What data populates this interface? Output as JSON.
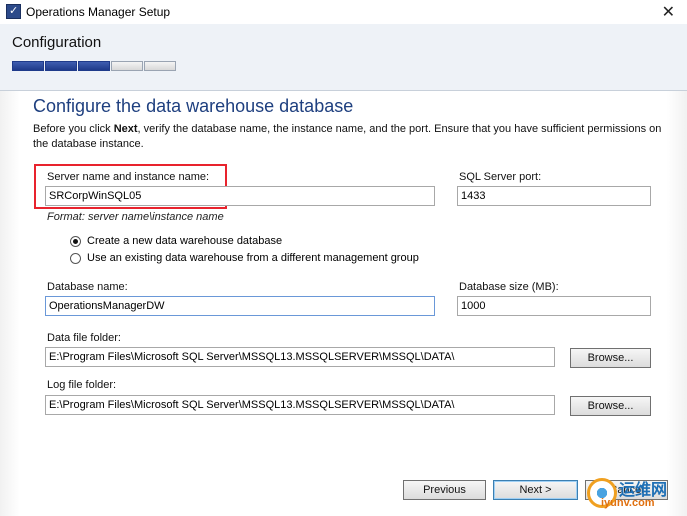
{
  "window": {
    "title": "Operations Manager Setup",
    "close_glyph": "✕"
  },
  "header": {
    "title": "Configuration",
    "progress": {
      "total_steps": 5,
      "completed_steps": 3,
      "filled_color": "#1e3a8a"
    }
  },
  "page": {
    "title": "Configure the data warehouse database",
    "instructions_pre": "Before you click ",
    "instructions_bold": "Next",
    "instructions_post": ", verify the database name, the instance name, and the port. Ensure that you have sufficient permissions on the database instance."
  },
  "server": {
    "label": "Server name and instance name:",
    "value": "SRCorpWinSQL05",
    "format_hint": "Format: server name\\instance name"
  },
  "port": {
    "label": "SQL Server port:",
    "value": "1433"
  },
  "options": [
    {
      "label": "Create a new data warehouse database",
      "checked": true
    },
    {
      "label": "Use an existing data warehouse from a different management group",
      "checked": false
    }
  ],
  "database_name": {
    "label": "Database name:",
    "value": "OperationsManagerDW"
  },
  "database_size": {
    "label": "Database size (MB):",
    "value": "1000"
  },
  "data_folder": {
    "label": "Data file folder:",
    "value": "E:\\Program Files\\Microsoft SQL Server\\MSSQL13.MSSQLSERVER\\MSSQL\\DATA\\",
    "browse_label": "Browse..."
  },
  "log_folder": {
    "label": "Log file folder:",
    "value": "E:\\Program Files\\Microsoft SQL Server\\MSSQL13.MSSQLSERVER\\MSSQL\\DATA\\",
    "browse_label": "Browse..."
  },
  "footer": {
    "previous_label": "Previous",
    "next_label": "Next >",
    "cancel_label": "Cancel"
  },
  "watermark": {
    "cn_text": "运维网",
    "url_text": "iyunv.com",
    "accent_color": "#f0a020"
  },
  "colors": {
    "title_blue": "#1e3f7f",
    "highlight_red": "#e8232d"
  }
}
